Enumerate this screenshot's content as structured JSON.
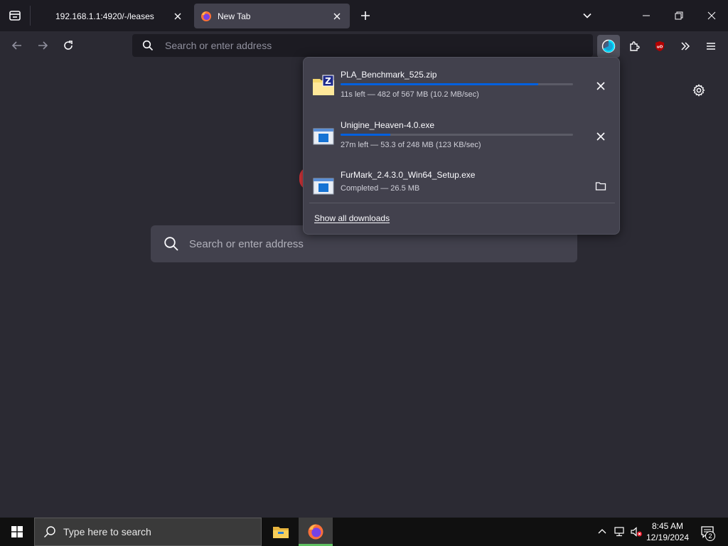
{
  "tabs": [
    {
      "title": "192.168.1.1:4920/-/leases",
      "active": false
    },
    {
      "title": "New Tab",
      "active": true
    }
  ],
  "urlbar": {
    "placeholder": "Search or enter address"
  },
  "content": {
    "search_placeholder": "Search or enter address"
  },
  "downloads": {
    "items": [
      {
        "name": "PLA_Benchmark_525.zip",
        "status": "11s left — 482 of 567 MB (10.2 MB/sec)",
        "progress": 0.85,
        "state": "downloading"
      },
      {
        "name": "Unigine_Heaven-4.0.exe",
        "status": "27m left — 53.3 of 248 MB (123 KB/sec)",
        "progress": 0.215,
        "state": "downloading"
      },
      {
        "name": "FurMark_2.4.3.0_Win64_Setup.exe",
        "status": "Completed — 26.5 MB",
        "progress": 1.0,
        "state": "completed"
      }
    ],
    "show_all": "Show all downloads"
  },
  "taskbar": {
    "search_placeholder": "Type here to search",
    "time": "8:45 AM",
    "date": "12/19/2024",
    "notification_count": "2"
  },
  "colors": {
    "accent": "#0060df",
    "toolbar": "#2b2a33",
    "panel": "#42414d",
    "taskbar_active": "#5ebf60"
  }
}
